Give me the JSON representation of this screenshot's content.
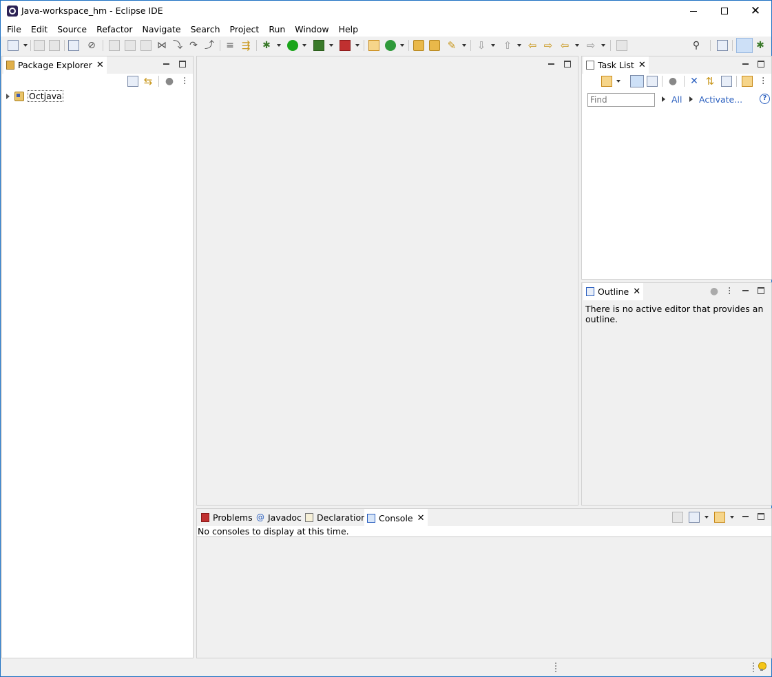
{
  "window": {
    "title": "Java-workspace_hm - Eclipse IDE"
  },
  "menu": [
    "File",
    "Edit",
    "Source",
    "Refactor",
    "Navigate",
    "Search",
    "Project",
    "Run",
    "Window",
    "Help"
  ],
  "package_explorer": {
    "tab_label": "Package Explorer",
    "project": "Octjava"
  },
  "task_list": {
    "tab_label": "Task List",
    "find_placeholder": "Find",
    "all_label": "All",
    "activate_label": "Activate..."
  },
  "outline": {
    "tab_label": "Outline",
    "message": "There is no active editor that provides an outline."
  },
  "bottom_panel": {
    "tabs": [
      "Problems",
      "Javadoc",
      "Declaration",
      "Console"
    ],
    "console_message": "No consoles to display at this time."
  }
}
